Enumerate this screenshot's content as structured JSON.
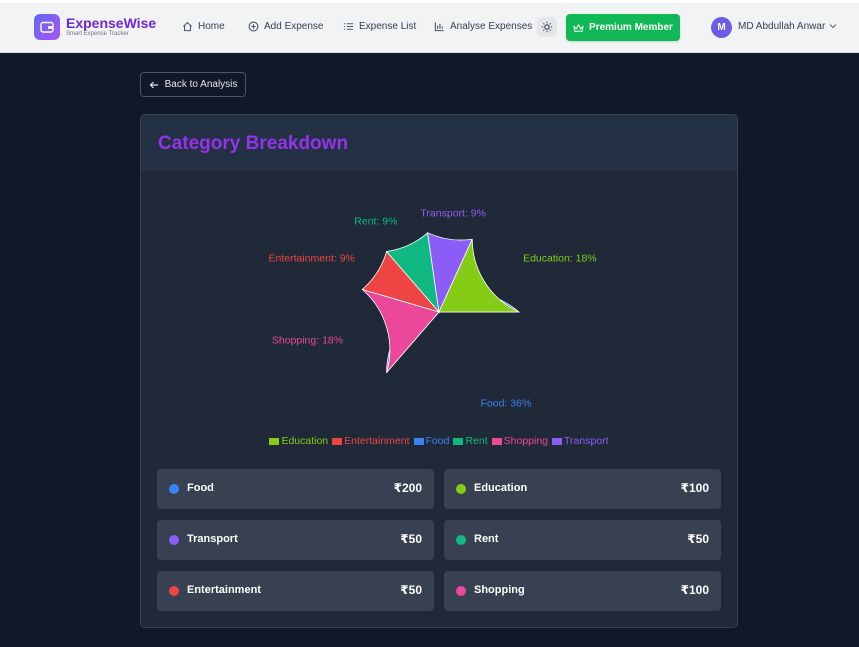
{
  "app": {
    "name": "ExpenseWise",
    "tagline": "Smart Expense Tracker",
    "brand_color": "#6d28d9"
  },
  "nav": {
    "items": [
      {
        "label": "Home",
        "icon": "home-icon"
      },
      {
        "label": "Add Expense",
        "icon": "plus-circle-icon"
      },
      {
        "label": "Expense List",
        "icon": "list-icon"
      },
      {
        "label": "Analyse Expenses",
        "icon": "bar-chart-icon"
      }
    ],
    "theme_toggle_icon": "sun-icon",
    "premium_label": "Premium Member",
    "premium_icon": "crown-icon",
    "premium_color": "#10b955",
    "user": {
      "initial": "M",
      "name": "MD Abdullah Anwar"
    }
  },
  "back_button": {
    "label": "Back to Analysis",
    "icon": "arrow-left-icon"
  },
  "card": {
    "title": "Category Breakdown",
    "title_color": "#9333ea"
  },
  "chart_data": {
    "type": "pie",
    "title": "",
    "slices": [
      {
        "name": "Food",
        "value": 200,
        "label": "Food: 36%",
        "color": "#3b82f6"
      },
      {
        "name": "Shopping",
        "value": 100,
        "label": "Shopping: 18%",
        "color": "#ec4899"
      },
      {
        "name": "Entertainment",
        "value": 50,
        "label": "Entertainment: 9%",
        "color": "#ef4444"
      },
      {
        "name": "Rent",
        "value": 50,
        "label": "Rent: 9%",
        "color": "#10b981"
      },
      {
        "name": "Transport",
        "value": 50,
        "label": "Transport: 9%",
        "color": "#8b5cf6"
      },
      {
        "name": "Education",
        "value": 100,
        "label": "Education: 18%",
        "color": "#84cc16"
      }
    ],
    "legend": [
      {
        "name": "Education",
        "color": "#84cc16"
      },
      {
        "name": "Entertainment",
        "color": "#ef4444"
      },
      {
        "name": "Food",
        "color": "#3b82f6"
      },
      {
        "name": "Rent",
        "color": "#10b981"
      },
      {
        "name": "Shopping",
        "color": "#ec4899"
      },
      {
        "name": "Transport",
        "color": "#8b5cf6"
      }
    ],
    "legend_position": "bottom"
  },
  "categories": [
    {
      "name": "Food",
      "amount": "₹200",
      "color": "#3b82f6"
    },
    {
      "name": "Education",
      "amount": "₹100",
      "color": "#84cc16"
    },
    {
      "name": "Transport",
      "amount": "₹50",
      "color": "#8b5cf6"
    },
    {
      "name": "Rent",
      "amount": "₹50",
      "color": "#10b981"
    },
    {
      "name": "Entertainment",
      "amount": "₹50",
      "color": "#ef4444"
    },
    {
      "name": "Shopping",
      "amount": "₹100",
      "color": "#ec4899"
    }
  ]
}
